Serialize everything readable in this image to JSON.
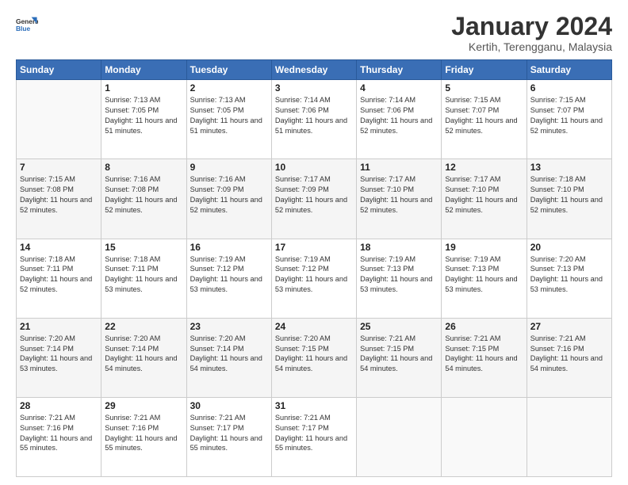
{
  "logo": {
    "general": "General",
    "blue": "Blue"
  },
  "title": "January 2024",
  "location": "Kertih, Terengganu, Malaysia",
  "days_of_week": [
    "Sunday",
    "Monday",
    "Tuesday",
    "Wednesday",
    "Thursday",
    "Friday",
    "Saturday"
  ],
  "weeks": [
    [
      {
        "day": "",
        "sunrise": "",
        "sunset": "",
        "daylight": ""
      },
      {
        "day": "1",
        "sunrise": "Sunrise: 7:13 AM",
        "sunset": "Sunset: 7:05 PM",
        "daylight": "Daylight: 11 hours and 51 minutes."
      },
      {
        "day": "2",
        "sunrise": "Sunrise: 7:13 AM",
        "sunset": "Sunset: 7:05 PM",
        "daylight": "Daylight: 11 hours and 51 minutes."
      },
      {
        "day": "3",
        "sunrise": "Sunrise: 7:14 AM",
        "sunset": "Sunset: 7:06 PM",
        "daylight": "Daylight: 11 hours and 51 minutes."
      },
      {
        "day": "4",
        "sunrise": "Sunrise: 7:14 AM",
        "sunset": "Sunset: 7:06 PM",
        "daylight": "Daylight: 11 hours and 52 minutes."
      },
      {
        "day": "5",
        "sunrise": "Sunrise: 7:15 AM",
        "sunset": "Sunset: 7:07 PM",
        "daylight": "Daylight: 11 hours and 52 minutes."
      },
      {
        "day": "6",
        "sunrise": "Sunrise: 7:15 AM",
        "sunset": "Sunset: 7:07 PM",
        "daylight": "Daylight: 11 hours and 52 minutes."
      }
    ],
    [
      {
        "day": "7",
        "sunrise": "Sunrise: 7:15 AM",
        "sunset": "Sunset: 7:08 PM",
        "daylight": "Daylight: 11 hours and 52 minutes."
      },
      {
        "day": "8",
        "sunrise": "Sunrise: 7:16 AM",
        "sunset": "Sunset: 7:08 PM",
        "daylight": "Daylight: 11 hours and 52 minutes."
      },
      {
        "day": "9",
        "sunrise": "Sunrise: 7:16 AM",
        "sunset": "Sunset: 7:09 PM",
        "daylight": "Daylight: 11 hours and 52 minutes."
      },
      {
        "day": "10",
        "sunrise": "Sunrise: 7:17 AM",
        "sunset": "Sunset: 7:09 PM",
        "daylight": "Daylight: 11 hours and 52 minutes."
      },
      {
        "day": "11",
        "sunrise": "Sunrise: 7:17 AM",
        "sunset": "Sunset: 7:10 PM",
        "daylight": "Daylight: 11 hours and 52 minutes."
      },
      {
        "day": "12",
        "sunrise": "Sunrise: 7:17 AM",
        "sunset": "Sunset: 7:10 PM",
        "daylight": "Daylight: 11 hours and 52 minutes."
      },
      {
        "day": "13",
        "sunrise": "Sunrise: 7:18 AM",
        "sunset": "Sunset: 7:10 PM",
        "daylight": "Daylight: 11 hours and 52 minutes."
      }
    ],
    [
      {
        "day": "14",
        "sunrise": "Sunrise: 7:18 AM",
        "sunset": "Sunset: 7:11 PM",
        "daylight": "Daylight: 11 hours and 52 minutes."
      },
      {
        "day": "15",
        "sunrise": "Sunrise: 7:18 AM",
        "sunset": "Sunset: 7:11 PM",
        "daylight": "Daylight: 11 hours and 53 minutes."
      },
      {
        "day": "16",
        "sunrise": "Sunrise: 7:19 AM",
        "sunset": "Sunset: 7:12 PM",
        "daylight": "Daylight: 11 hours and 53 minutes."
      },
      {
        "day": "17",
        "sunrise": "Sunrise: 7:19 AM",
        "sunset": "Sunset: 7:12 PM",
        "daylight": "Daylight: 11 hours and 53 minutes."
      },
      {
        "day": "18",
        "sunrise": "Sunrise: 7:19 AM",
        "sunset": "Sunset: 7:13 PM",
        "daylight": "Daylight: 11 hours and 53 minutes."
      },
      {
        "day": "19",
        "sunrise": "Sunrise: 7:19 AM",
        "sunset": "Sunset: 7:13 PM",
        "daylight": "Daylight: 11 hours and 53 minutes."
      },
      {
        "day": "20",
        "sunrise": "Sunrise: 7:20 AM",
        "sunset": "Sunset: 7:13 PM",
        "daylight": "Daylight: 11 hours and 53 minutes."
      }
    ],
    [
      {
        "day": "21",
        "sunrise": "Sunrise: 7:20 AM",
        "sunset": "Sunset: 7:14 PM",
        "daylight": "Daylight: 11 hours and 53 minutes."
      },
      {
        "day": "22",
        "sunrise": "Sunrise: 7:20 AM",
        "sunset": "Sunset: 7:14 PM",
        "daylight": "Daylight: 11 hours and 54 minutes."
      },
      {
        "day": "23",
        "sunrise": "Sunrise: 7:20 AM",
        "sunset": "Sunset: 7:14 PM",
        "daylight": "Daylight: 11 hours and 54 minutes."
      },
      {
        "day": "24",
        "sunrise": "Sunrise: 7:20 AM",
        "sunset": "Sunset: 7:15 PM",
        "daylight": "Daylight: 11 hours and 54 minutes."
      },
      {
        "day": "25",
        "sunrise": "Sunrise: 7:21 AM",
        "sunset": "Sunset: 7:15 PM",
        "daylight": "Daylight: 11 hours and 54 minutes."
      },
      {
        "day": "26",
        "sunrise": "Sunrise: 7:21 AM",
        "sunset": "Sunset: 7:15 PM",
        "daylight": "Daylight: 11 hours and 54 minutes."
      },
      {
        "day": "27",
        "sunrise": "Sunrise: 7:21 AM",
        "sunset": "Sunset: 7:16 PM",
        "daylight": "Daylight: 11 hours and 54 minutes."
      }
    ],
    [
      {
        "day": "28",
        "sunrise": "Sunrise: 7:21 AM",
        "sunset": "Sunset: 7:16 PM",
        "daylight": "Daylight: 11 hours and 55 minutes."
      },
      {
        "day": "29",
        "sunrise": "Sunrise: 7:21 AM",
        "sunset": "Sunset: 7:16 PM",
        "daylight": "Daylight: 11 hours and 55 minutes."
      },
      {
        "day": "30",
        "sunrise": "Sunrise: 7:21 AM",
        "sunset": "Sunset: 7:17 PM",
        "daylight": "Daylight: 11 hours and 55 minutes."
      },
      {
        "day": "31",
        "sunrise": "Sunrise: 7:21 AM",
        "sunset": "Sunset: 7:17 PM",
        "daylight": "Daylight: 11 hours and 55 minutes."
      },
      {
        "day": "",
        "sunrise": "",
        "sunset": "",
        "daylight": ""
      },
      {
        "day": "",
        "sunrise": "",
        "sunset": "",
        "daylight": ""
      },
      {
        "day": "",
        "sunrise": "",
        "sunset": "",
        "daylight": ""
      }
    ]
  ]
}
